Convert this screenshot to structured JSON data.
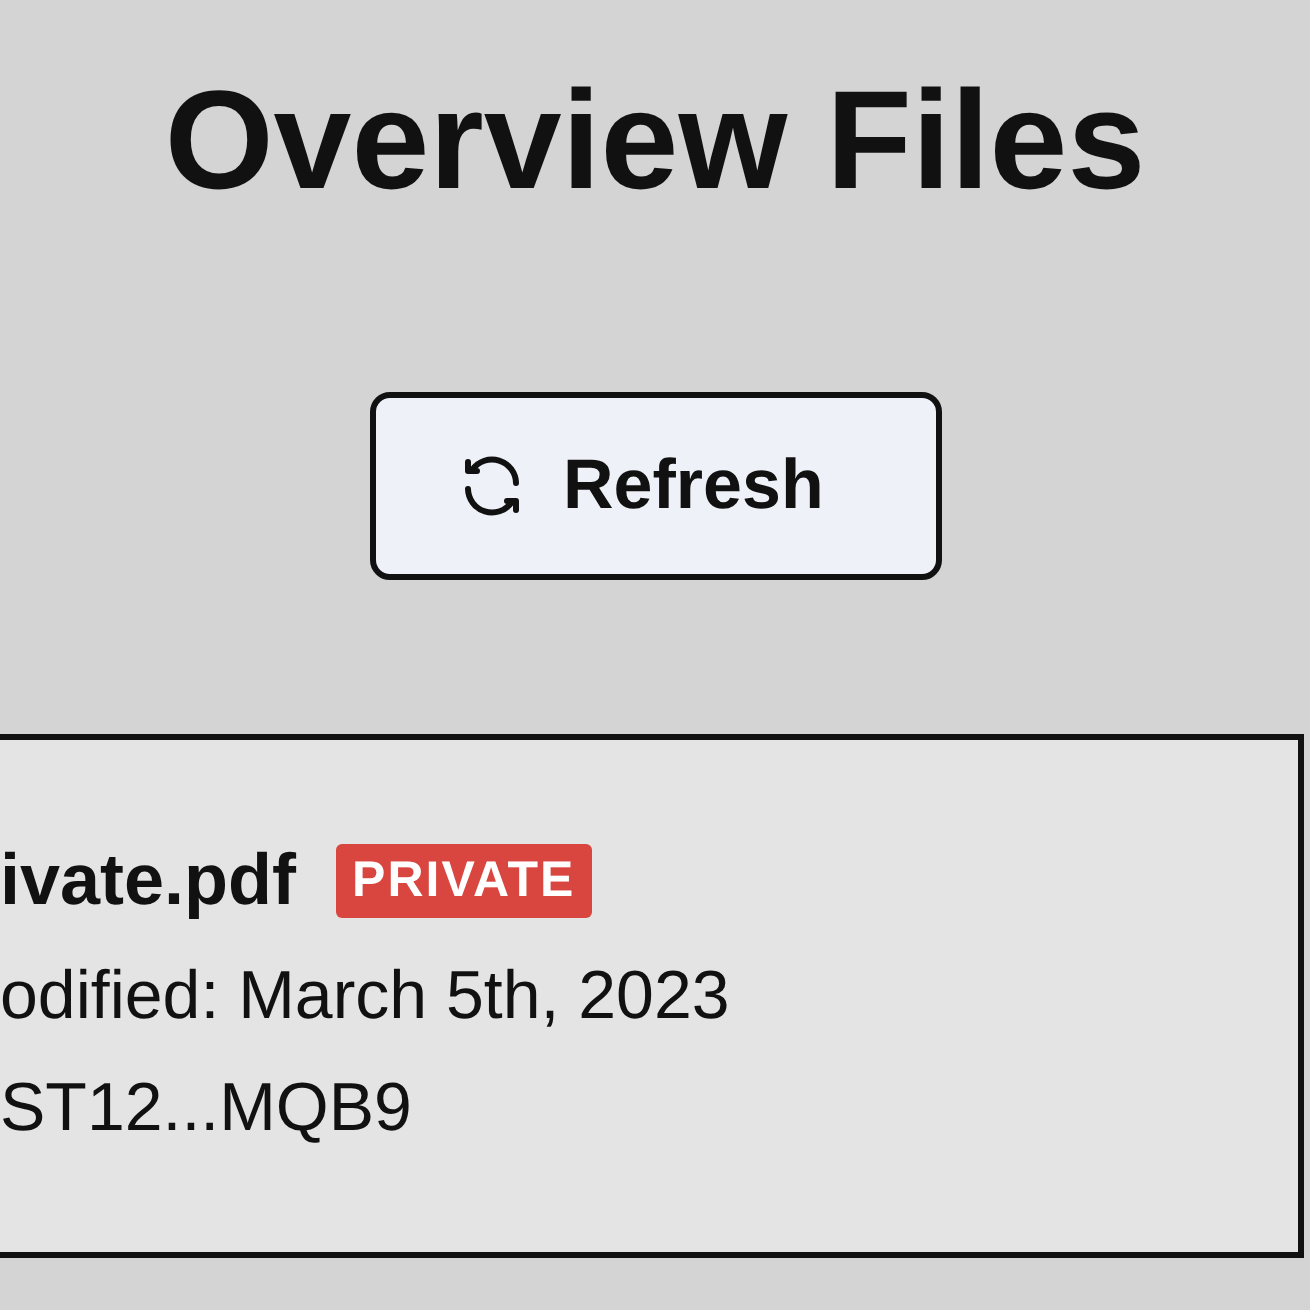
{
  "title": "Overview Files",
  "refresh_button": {
    "label": "Refresh"
  },
  "file_card": {
    "name": "ivate.pdf",
    "badge": "PRIVATE",
    "modified": "odified: March 5th, 2023",
    "id": "ST12...MQB9"
  }
}
